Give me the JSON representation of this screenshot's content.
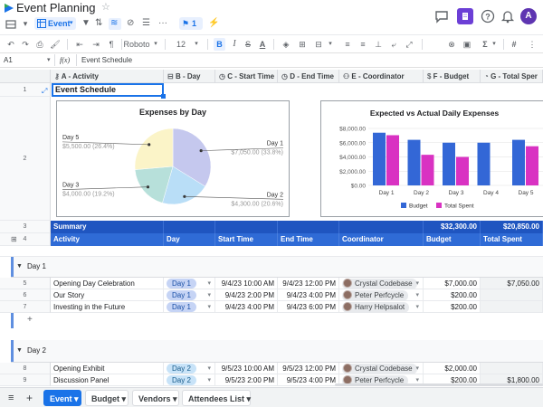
{
  "app": {
    "title": "Event Planning",
    "avatar_letter": "A",
    "view_name": "Event",
    "collaborators_count": "1"
  },
  "toolbar": {
    "font": "Roboto",
    "font_size": "12",
    "bold": "B",
    "italic": "I",
    "strike": "S",
    "underline_color": "A",
    "function_sym": "Σ",
    "hash": "#"
  },
  "formula_bar": {
    "cell_ref": "A1",
    "fx": "f(x)",
    "value": "Event Schedule"
  },
  "columns": [
    {
      "label": "A - Activity",
      "icon": "key-icon"
    },
    {
      "label": "B - Day",
      "icon": "select-icon"
    },
    {
      "label": "C - Start Time",
      "icon": "clock-icon"
    },
    {
      "label": "D - End Time",
      "icon": "clock-icon"
    },
    {
      "label": "E - Coordinator",
      "icon": "person-icon"
    },
    {
      "label": "F - Budget",
      "icon": "dollar-icon"
    },
    {
      "label": "G - Total Sper",
      "icon": "formula-icon"
    }
  ],
  "rows": {
    "r1": "1",
    "r2": "2",
    "r3": "3",
    "r4": "4",
    "r5": "5",
    "r6": "6",
    "r7": "7",
    "r8": "8",
    "r9": "9"
  },
  "title_cell": "Event Schedule",
  "summary": {
    "label": "Summary",
    "budget": "$32,300.00",
    "total_spent": "$20,850.00"
  },
  "headers": [
    "Activity",
    "Day",
    "Start Time",
    "End Time",
    "Coordinator",
    "Budget",
    "Total Spent"
  ],
  "group1": {
    "label": "Day 1",
    "rows": [
      {
        "activity": "Opening Day Celebration",
        "day": "Day 1",
        "start": "9/4/23 10:00 AM",
        "end": "9/4/23 12:00 PM",
        "coordinator": "Crystal Codebase",
        "budget": "$7,000.00",
        "spent": "$7,050.00"
      },
      {
        "activity": "Our Story",
        "day": "Day 1",
        "start": "9/4/23 2:00 PM",
        "end": "9/4/23 4:00 PM",
        "coordinator": "Peter Perfcycle",
        "budget": "$200.00",
        "spent": ""
      },
      {
        "activity": "Investing in the Future",
        "day": "Day 1",
        "start": "9/4/23 4:00 PM",
        "end": "9/4/23 6:00 PM",
        "coordinator": "Harry Helpsalot",
        "budget": "$200.00",
        "spent": ""
      }
    ]
  },
  "group2": {
    "label": "Day 2",
    "rows": [
      {
        "activity": "Opening Exhibit",
        "day": "Day 2",
        "start": "9/5/23 10:00 AM",
        "end": "9/5/23 12:00 PM",
        "coordinator": "Crystal Codebase",
        "budget": "$2,000.00",
        "spent": ""
      },
      {
        "activity": "Discussion Panel",
        "day": "Day 2",
        "start": "9/5/23 2:00 PM",
        "end": "9/5/23 4:00 PM",
        "coordinator": "Peter Perfcycle",
        "budget": "$200.00",
        "spent": "$1,800.00"
      }
    ]
  },
  "add_row": "+",
  "sheets": [
    "Event",
    "Budget",
    "Vendors",
    "Attendees List"
  ],
  "chart_data": [
    {
      "type": "pie",
      "title": "Expenses by Day",
      "categories": [
        "Day 1",
        "Day 2",
        "Day 3",
        "Day 5"
      ],
      "values": [
        7050,
        4300,
        4000,
        5500
      ],
      "labels": [
        "$7,050.00 (33.8%)",
        "$4,300.00 (20.6%)",
        "$4,000.00 (19.2%)",
        "$5,500.00 (26.4%)"
      ],
      "colors": [
        "#c5c8ee",
        "#b9def7",
        "#b7e0da",
        "#fbf4c8"
      ]
    },
    {
      "type": "bar",
      "title": "Expected vs Actual Daily Expenses",
      "categories": [
        "Day 1",
        "Day 2",
        "Day 3",
        "Day 4",
        "Day 5"
      ],
      "series": [
        {
          "name": "Budget",
          "values": [
            7400,
            6400,
            6000,
            6000,
            6400
          ],
          "color": "#3367d6"
        },
        {
          "name": "Total Spent",
          "values": [
            7050,
            4300,
            4000,
            0,
            5500
          ],
          "color": "#d932c2"
        }
      ],
      "ylim": [
        0,
        8000
      ],
      "yticks": [
        "$0.00",
        "$2,000.00",
        "$4,000.00",
        "$6,000.00",
        "$8,000.00"
      ],
      "legend": "bottom",
      "grid": true
    }
  ]
}
